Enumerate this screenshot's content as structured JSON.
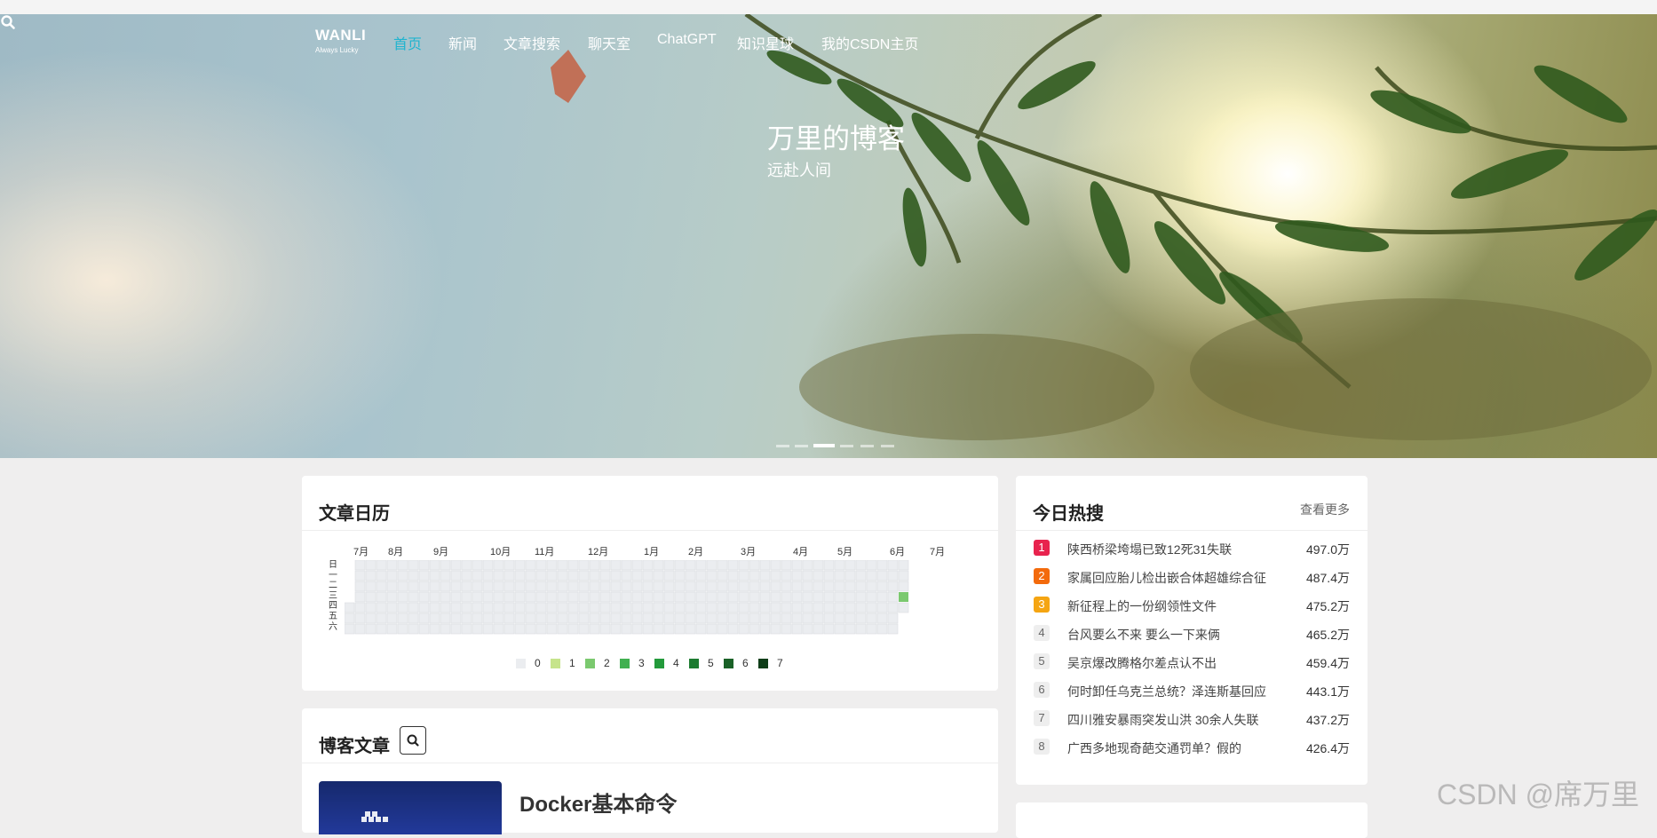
{
  "nav": {
    "logo_name": "WANLI",
    "logo_tagline": "Always Lucky",
    "items": [
      {
        "label": "首页"
      },
      {
        "label": "新闻"
      },
      {
        "label": "文章搜索"
      },
      {
        "label": "聊天室"
      },
      {
        "label": "ChatGPT"
      },
      {
        "label": "知识星球"
      },
      {
        "label": "我的CSDN主页"
      }
    ],
    "active_index": 0,
    "search_icon": "search-icon"
  },
  "hero": {
    "title": "万里的博客",
    "subtitle": "远赴人间",
    "slide_count": 6,
    "active_slide": 2
  },
  "calendar": {
    "title": "文章日历",
    "months": [
      "7月",
      "8月",
      "9月",
      "10月",
      "11月",
      "12月",
      "1月",
      "2月",
      "3月",
      "4月",
      "5月",
      "6月",
      "7月"
    ],
    "weekdays": [
      "日",
      "一",
      "二",
      "三",
      "四",
      "五",
      "六"
    ],
    "legend": [
      "0",
      "1",
      "2",
      "3",
      "4",
      "5",
      "6",
      "7"
    ],
    "legend_colors": [
      "#ebedf0",
      "#c6e48b",
      "#7bc96f",
      "#40b050",
      "#239a3b",
      "#1c7b30",
      "#196127",
      "#0e3d18"
    ],
    "active_cells": [
      {
        "week": 52,
        "day": 3,
        "level": 2
      }
    ]
  },
  "hot": {
    "title": "今日热搜",
    "more": "查看更多",
    "rank_colors": [
      "#e8234e",
      "#f36a0c",
      "#f5a512"
    ],
    "items": [
      {
        "rank": "1",
        "text": "陕西桥梁垮塌已致12死31失联",
        "value": "497.0万"
      },
      {
        "rank": "2",
        "text": "家属回应胎儿检出嵌合体超雄综合征",
        "value": "487.4万"
      },
      {
        "rank": "3",
        "text": "新征程上的一份纲领性文件",
        "value": "475.2万"
      },
      {
        "rank": "4",
        "text": "台风要么不来 要么一下来俩",
        "value": "465.2万"
      },
      {
        "rank": "5",
        "text": "吴京爆改腾格尔差点认不出",
        "value": "459.4万"
      },
      {
        "rank": "6",
        "text": "何时卸任乌克兰总统？泽连斯基回应",
        "value": "443.1万"
      },
      {
        "rank": "7",
        "text": "四川雅安暴雨突发山洪 30余人失联",
        "value": "437.2万"
      },
      {
        "rank": "8",
        "text": "广西多地现奇葩交通罚单？假的",
        "value": "426.4万"
      }
    ]
  },
  "blog": {
    "title": "博客文章",
    "search_icon": "search-icon",
    "post_title": "Docker基本命令"
  },
  "watermark": "CSDN @席万里"
}
